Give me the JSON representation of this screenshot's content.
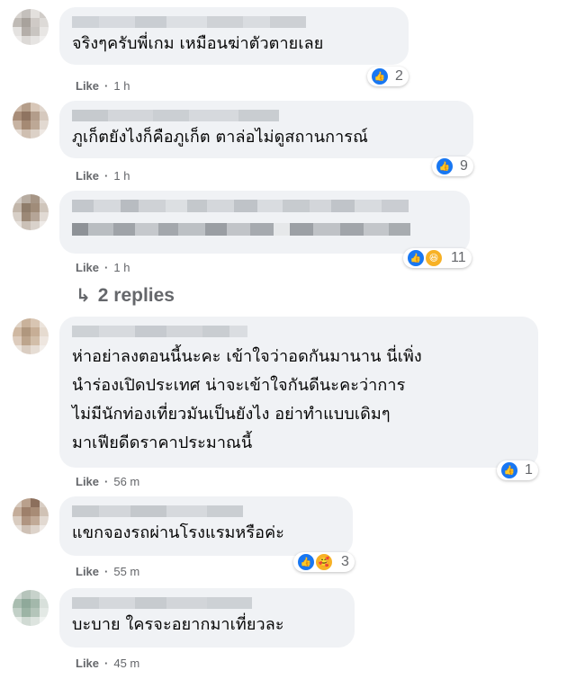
{
  "comments": [
    {
      "text": "จริงๆครับพี่เกม เหมือนฆ่าตัวตายเลย",
      "like": "Like",
      "time": "1 h",
      "reaction_count": "2"
    },
    {
      "text": "ภูเก็ตยังไงก็คือภูเก็ต ตาล่อไม่ดูสถานการณ์",
      "like": "Like",
      "time": "1 h",
      "reaction_count": "9"
    },
    {
      "text": "",
      "like": "Like",
      "time": "1 h",
      "reaction_count": "11"
    },
    {
      "text": "ห่าอย่าลงตอนนี้นะคะ เข้าใจว่าอดกันมานาน นี่เพิ่ง\nนำร่องเปิดประเทศ น่าจะเข้าใจกันดีนะคะว่าการ\nไม่มีนักท่องเที่ยวมันเป็นยังไง อย่าทำแบบเดิมๆ\nมาเฟียดีดราคาประมาณนี้",
      "like": "Like",
      "time": "56 m",
      "reaction_count": "1"
    },
    {
      "text": "แขกจองรถผ่านโรงแรมหรือค่ะ",
      "like": "Like",
      "time": "55 m",
      "reaction_count": "3"
    },
    {
      "text": "บะบาย ใครจะอยากมาเที่ยวละ",
      "like": "Like",
      "time": "45 m",
      "reaction_count": ""
    }
  ],
  "replies_label": "2 replies",
  "icons": {
    "like": "like-icon",
    "haha": "haha-icon",
    "care": "care-icon",
    "reply_arrow": "reply-arrow-icon"
  },
  "colors": {
    "bubble": "#f0f2f5",
    "meta": "#65676b",
    "like_blue": "#1877f2"
  }
}
